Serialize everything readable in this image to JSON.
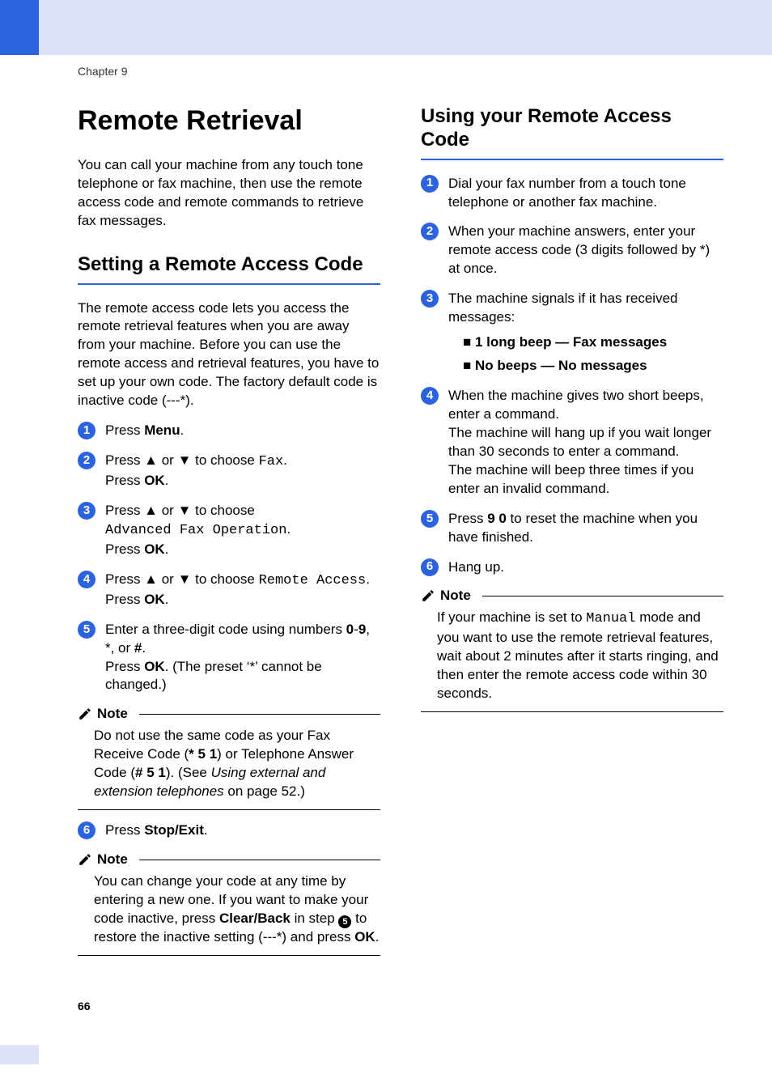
{
  "chapter": "Chapter 9",
  "page_number": "66",
  "left": {
    "title": "Remote Retrieval",
    "intro": "You can call your machine from any touch tone telephone or fax machine, then use the remote access code and remote commands to retrieve fax messages.",
    "section_title": "Setting a Remote Access Code",
    "section_intro": "The remote access code lets you access the remote retrieval features when you are away from your machine. Before you can use the remote access and retrieval features, you have to set up your own code. The factory default code is inactive code (---*).",
    "steps": {
      "s1_a": "Press ",
      "s1_b": "Menu",
      "s1_c": ".",
      "s2_a": "Press ▲ or ▼ to choose ",
      "s2_b": "Fax",
      "s2_c": ".",
      "s2_d": "Press ",
      "s2_e": "OK",
      "s2_f": ".",
      "s3_a": "Press ▲ or ▼ to choose ",
      "s3_b": "Advanced Fax Operation",
      "s3_c": ".",
      "s3_d": "Press ",
      "s3_e": "OK",
      "s3_f": ".",
      "s4_a": "Press ▲ or ▼ to choose ",
      "s4_b": "Remote Access",
      "s4_c": ".",
      "s4_d": "Press ",
      "s4_e": "OK",
      "s4_f": ".",
      "s5_a": "Enter a three-digit code using numbers ",
      "s5_b": "0",
      "s5_c": "-",
      "s5_d": "9",
      "s5_e": ", *, or ",
      "s5_f": "#",
      "s5_g": ".",
      "s5_h": "Press ",
      "s5_i": "OK",
      "s5_j": ". (The preset ‘*’ cannot be changed.)",
      "s6_a": "Press ",
      "s6_b": "Stop/Exit",
      "s6_c": "."
    },
    "note1": {
      "label": "Note",
      "a": "Do not use the same code as your Fax Receive Code (",
      "b": "* 5 1",
      "c": ") or Telephone Answer Code (",
      "d": "# 5 1",
      "e": "). (See ",
      "f": "Using external and extension telephones",
      "g": " on page 52.)"
    },
    "note2": {
      "label": "Note",
      "a": "You can change your code at any time by entering a new one. If you want to make your code inactive, press ",
      "b": "Clear/Back",
      "c": " in step ",
      "d": "5",
      "e": " to restore the inactive setting (---*) and press ",
      "f": "OK",
      "g": "."
    }
  },
  "right": {
    "section_title": "Using your Remote Access Code",
    "steps": {
      "s1": "Dial your fax number from a touch tone telephone or another fax machine.",
      "s2": "When your machine answers, enter your remote access code (3 digits followed by *) at once.",
      "s3_a": "The machine signals if it has received messages:",
      "s3_b1": "1 long beep — Fax messages",
      "s3_b2": "No beeps — No messages",
      "s4_a": "When the machine gives two short beeps, enter a command.",
      "s4_b": "The machine will hang up if you wait longer than 30 seconds to enter a command.",
      "s4_c": "The machine will beep three times if you enter an invalid command.",
      "s5_a": "Press ",
      "s5_b": "9 0",
      "s5_c": " to reset the machine when you have finished.",
      "s6": "Hang up."
    },
    "note": {
      "label": "Note",
      "a": "If your machine is set to ",
      "b": "Manual",
      "c": " mode and you want to use the remote retrieval features, wait about 2 minutes after it starts ringing, and then enter the remote access code within 30 seconds."
    }
  }
}
